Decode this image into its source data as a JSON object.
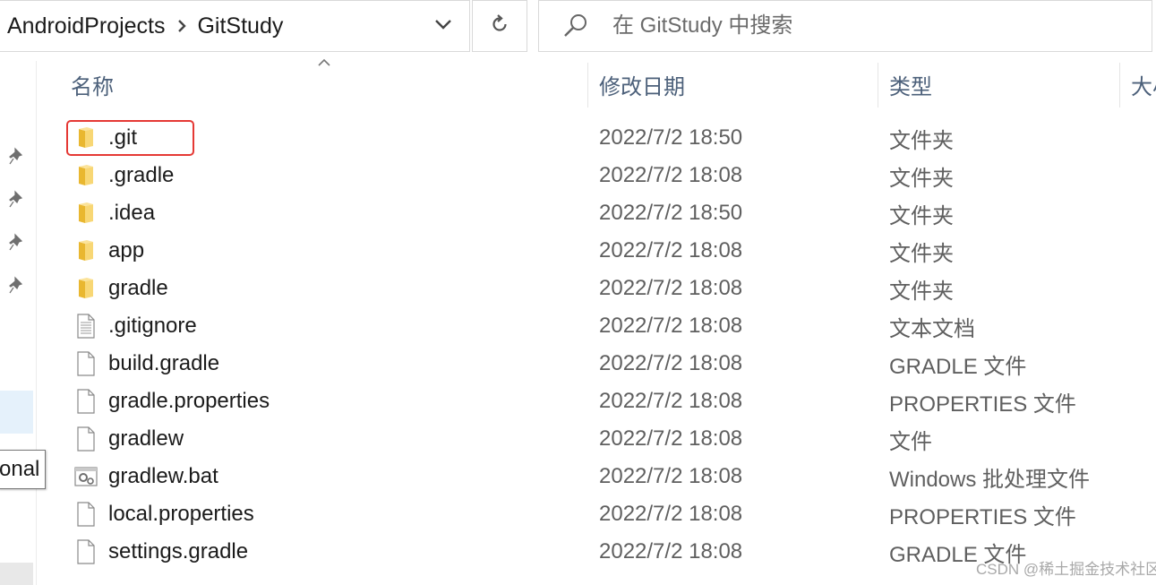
{
  "address_bar": {
    "breadcrumbs": [
      "AndroidProjects",
      "GitStudy"
    ]
  },
  "search": {
    "placeholder": "在 GitStudy 中搜索"
  },
  "tooltip": {
    "text": "onal"
  },
  "columns": {
    "name": "名称",
    "date_modified": "修改日期",
    "type": "类型",
    "size": "大小"
  },
  "files": [
    {
      "name": ".git",
      "date": "2022/7/2 18:50",
      "type": "文件夹",
      "icon": "folder-icon",
      "highlighted": true
    },
    {
      "name": ".gradle",
      "date": "2022/7/2 18:08",
      "type": "文件夹",
      "icon": "folder-icon"
    },
    {
      "name": ".idea",
      "date": "2022/7/2 18:50",
      "type": "文件夹",
      "icon": "folder-icon"
    },
    {
      "name": "app",
      "date": "2022/7/2 18:08",
      "type": "文件夹",
      "icon": "folder-icon"
    },
    {
      "name": "gradle",
      "date": "2022/7/2 18:08",
      "type": "文件夹",
      "icon": "folder-icon"
    },
    {
      "name": ".gitignore",
      "date": "2022/7/2 18:08",
      "type": "文本文档",
      "icon": "text-file-icon"
    },
    {
      "name": "build.gradle",
      "date": "2022/7/2 18:08",
      "type": "GRADLE 文件",
      "icon": "file-icon"
    },
    {
      "name": "gradle.properties",
      "date": "2022/7/2 18:08",
      "type": "PROPERTIES 文件",
      "icon": "file-icon"
    },
    {
      "name": "gradlew",
      "date": "2022/7/2 18:08",
      "type": "文件",
      "icon": "file-icon"
    },
    {
      "name": "gradlew.bat",
      "date": "2022/7/2 18:08",
      "type": "Windows 批处理文件",
      "icon": "batch-file-icon"
    },
    {
      "name": "local.properties",
      "date": "2022/7/2 18:08",
      "type": "PROPERTIES 文件",
      "icon": "file-icon"
    },
    {
      "name": "settings.gradle",
      "date": "2022/7/2 18:08",
      "type": "GRADLE 文件",
      "icon": "file-icon"
    }
  ],
  "watermark": "CSDN @稀土掘金技术社区",
  "colors": {
    "highlight_border": "#e53935",
    "header_text": "#4c607a",
    "folder_yellow": "#f4c542",
    "selection_blue": "#e5f1fb"
  }
}
